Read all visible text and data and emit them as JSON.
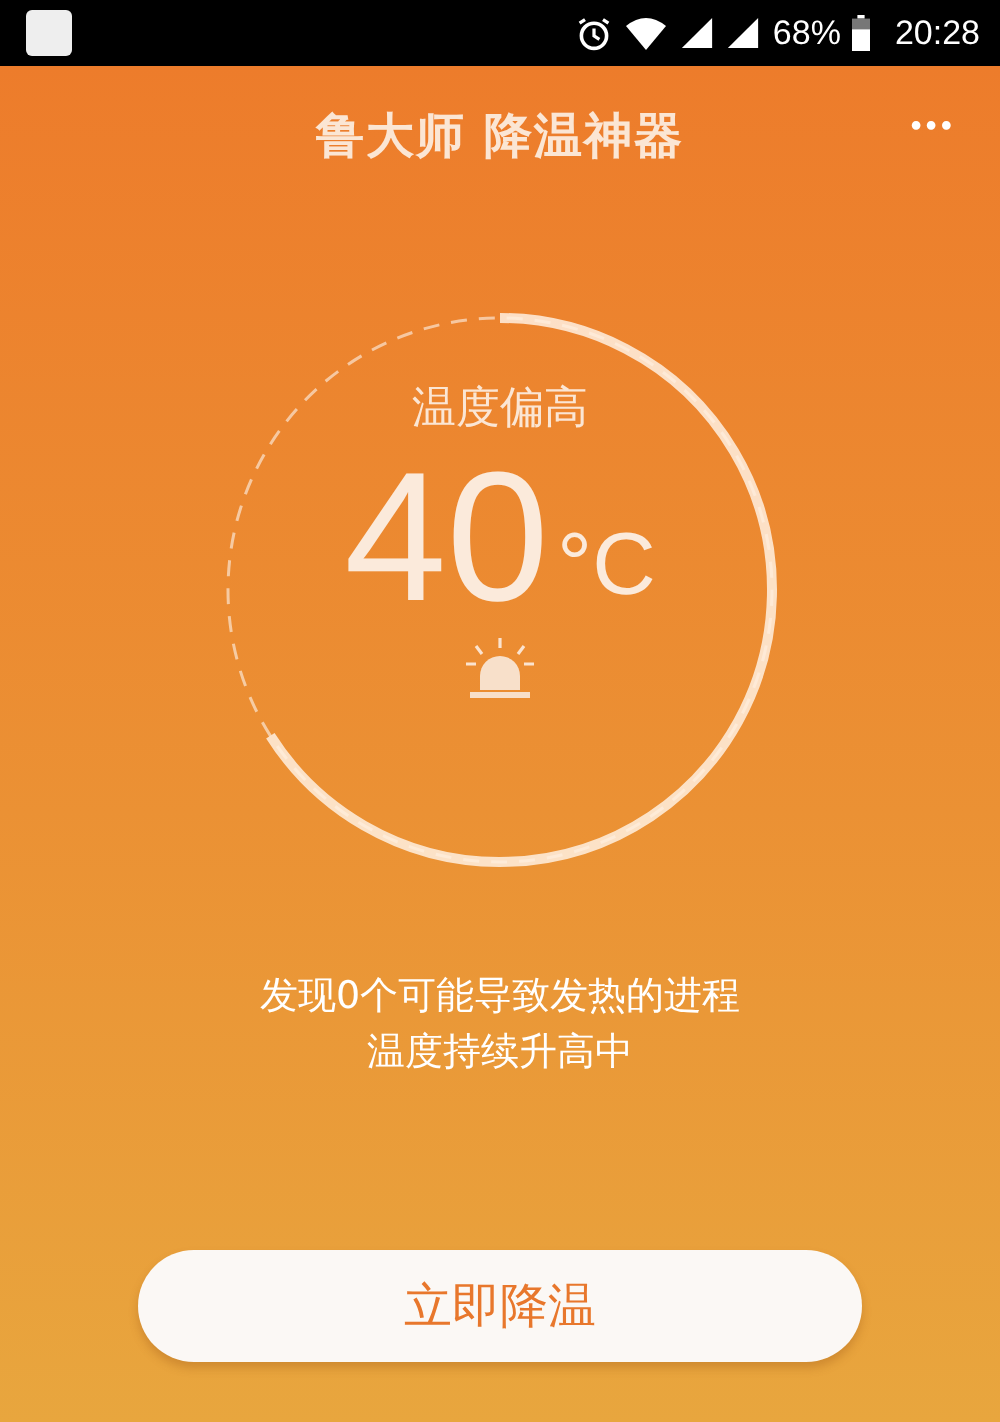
{
  "status_bar": {
    "battery": "68%",
    "time": "20:28"
  },
  "header": {
    "title": "鲁大师 降温神器",
    "menu": "•••"
  },
  "gauge": {
    "status": "温度偏高",
    "temperature": "40",
    "unit": "°C"
  },
  "message": [
    "发现0个可能导致发热的进程",
    "温度持续升高中"
  ],
  "action_button": "立即降温"
}
